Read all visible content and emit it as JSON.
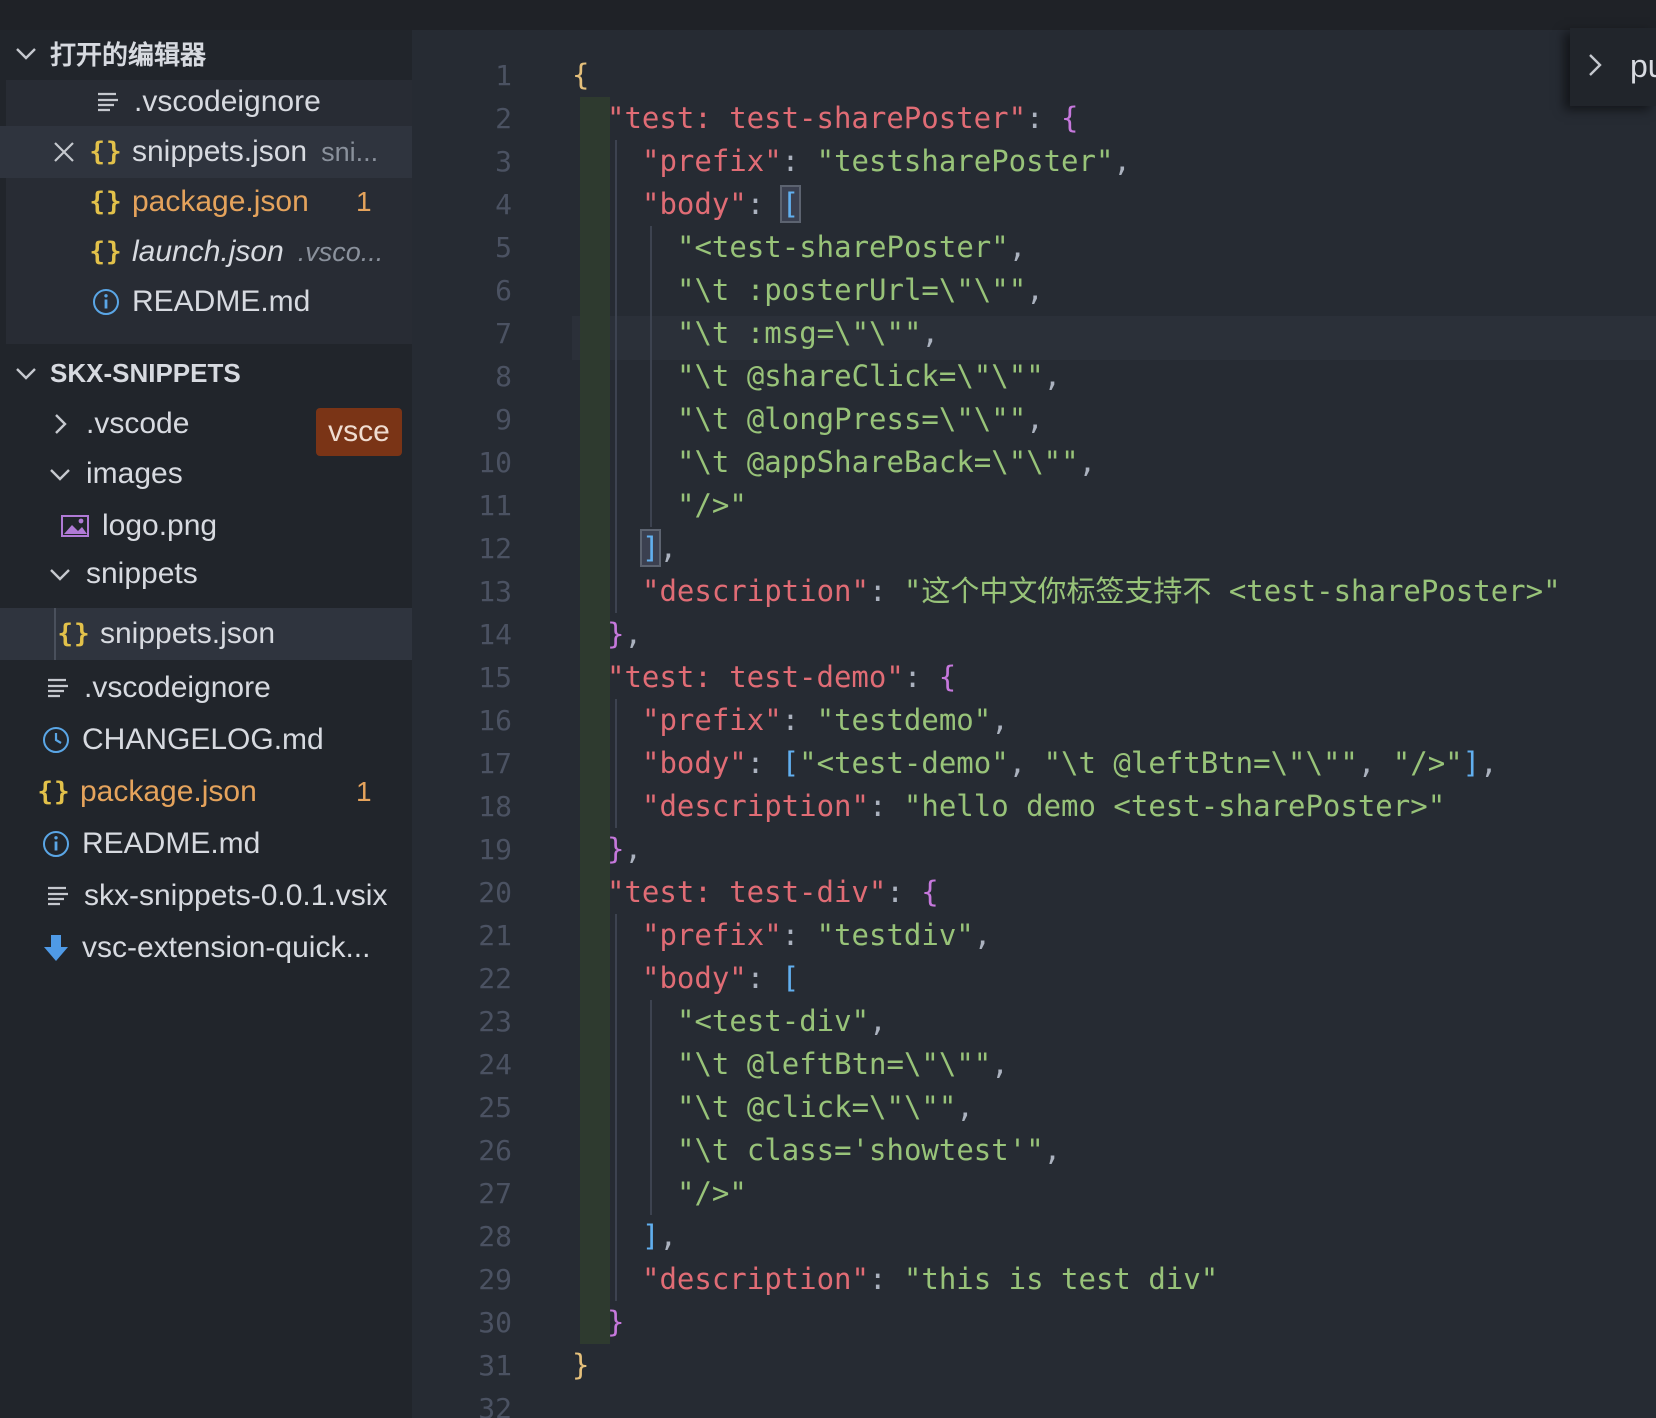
{
  "sidebar": {
    "open_editors_title": "打开的编辑器",
    "open_editors": [
      {
        "name": ".vscodeignore",
        "icon": "lines-icon",
        "desc": "",
        "badge": ""
      },
      {
        "name": "snippets.json",
        "icon": "braces-icon",
        "desc": "sni...",
        "badge": ""
      },
      {
        "name": "package.json",
        "icon": "braces-icon",
        "desc": "",
        "badge": "1"
      },
      {
        "name": "launch.json",
        "icon": "braces-icon",
        "desc": ".vsco...",
        "badge": ""
      },
      {
        "name": "README.md",
        "icon": "info-icon",
        "desc": "",
        "badge": ""
      }
    ],
    "braces_glyph": "{}",
    "project_title": "SKX-SNIPPETS",
    "tree": [
      {
        "name": ".vscode",
        "type": "folder-collapsed"
      },
      {
        "name": "images",
        "type": "folder-expanded"
      },
      {
        "name": "logo.png",
        "type": "image-file"
      },
      {
        "name": "snippets",
        "type": "folder-expanded"
      },
      {
        "name": "snippets.json",
        "type": "json-file"
      },
      {
        "name": ".vscodeignore",
        "type": "lines-file"
      },
      {
        "name": "CHANGELOG.md",
        "type": "clock-file"
      },
      {
        "name": "package.json",
        "type": "json-file",
        "badge": "1"
      },
      {
        "name": "README.md",
        "type": "info-file"
      },
      {
        "name": "skx-snippets-0.0.1.vsix",
        "type": "lines-file"
      },
      {
        "name": "vsc-extension-quick...",
        "type": "download-file"
      }
    ],
    "tooltip": "vsce"
  },
  "editor": {
    "peek_text": "pu",
    "line_numbers": [
      "1",
      "2",
      "3",
      "4",
      "5",
      "6",
      "7",
      "8",
      "9",
      "10",
      "11",
      "12",
      "13",
      "14",
      "15",
      "16",
      "17",
      "18",
      "19",
      "20",
      "21",
      "22",
      "23",
      "24",
      "25",
      "26",
      "27",
      "28",
      "29",
      "30",
      "31",
      "32"
    ],
    "lines": [
      {
        "indent": 0,
        "tokens": [
          {
            "t": "{",
            "c": "brace"
          }
        ]
      },
      {
        "indent": 1,
        "tokens": [
          {
            "t": "\"test: test-sharePoster\"",
            "c": "key"
          },
          {
            "t": ": ",
            "c": "punct"
          },
          {
            "t": "{",
            "c": "brace2"
          }
        ]
      },
      {
        "indent": 2,
        "tokens": [
          {
            "t": "\"prefix\"",
            "c": "key"
          },
          {
            "t": ": ",
            "c": "punct"
          },
          {
            "t": "\"testsharePoster\"",
            "c": "str"
          },
          {
            "t": ",",
            "c": "punct"
          }
        ]
      },
      {
        "indent": 2,
        "tokens": [
          {
            "t": "\"body\"",
            "c": "key"
          },
          {
            "t": ": ",
            "c": "punct"
          },
          {
            "t": "[",
            "c": "bracket-match"
          }
        ]
      },
      {
        "indent": 3,
        "tokens": [
          {
            "t": "\"<test-sharePoster\"",
            "c": "str"
          },
          {
            "t": ",",
            "c": "punct"
          }
        ]
      },
      {
        "indent": 3,
        "tokens": [
          {
            "t": "\"\\t :posterUrl=\\\"\\\"\"",
            "c": "str"
          },
          {
            "t": ",",
            "c": "punct"
          }
        ]
      },
      {
        "indent": 3,
        "tokens": [
          {
            "t": "\"\\t :msg=\\\"\\\"\"",
            "c": "str"
          },
          {
            "t": ",",
            "c": "punct"
          }
        ]
      },
      {
        "indent": 3,
        "tokens": [
          {
            "t": "\"\\t @shareClick=\\\"\\\"\"",
            "c": "str"
          },
          {
            "t": ",",
            "c": "punct"
          }
        ]
      },
      {
        "indent": 3,
        "tokens": [
          {
            "t": "\"\\t @longPress=\\\"\\\"\"",
            "c": "str"
          },
          {
            "t": ",",
            "c": "punct"
          }
        ]
      },
      {
        "indent": 3,
        "tokens": [
          {
            "t": "\"\\t @appShareBack=\\\"\\\"\"",
            "c": "str"
          },
          {
            "t": ",",
            "c": "punct"
          }
        ]
      },
      {
        "indent": 3,
        "tokens": [
          {
            "t": "\"/>\"",
            "c": "str"
          }
        ]
      },
      {
        "indent": 2,
        "tokens": [
          {
            "t": "]",
            "c": "bracket-match"
          },
          {
            "t": ",",
            "c": "punct"
          }
        ]
      },
      {
        "indent": 2,
        "tokens": [
          {
            "t": "\"description\"",
            "c": "key"
          },
          {
            "t": ": ",
            "c": "punct"
          },
          {
            "t": "\"这个中文你标签支持不 <test-sharePoster>\"",
            "c": "str"
          }
        ]
      },
      {
        "indent": 1,
        "tokens": [
          {
            "t": "}",
            "c": "brace2"
          },
          {
            "t": ",",
            "c": "punct"
          }
        ]
      },
      {
        "indent": 1,
        "tokens": [
          {
            "t": "\"test: test-demo\"",
            "c": "key"
          },
          {
            "t": ": ",
            "c": "punct"
          },
          {
            "t": "{",
            "c": "brace2"
          }
        ]
      },
      {
        "indent": 2,
        "tokens": [
          {
            "t": "\"prefix\"",
            "c": "key"
          },
          {
            "t": ": ",
            "c": "punct"
          },
          {
            "t": "\"testdemo\"",
            "c": "str"
          },
          {
            "t": ",",
            "c": "punct"
          }
        ]
      },
      {
        "indent": 2,
        "tokens": [
          {
            "t": "\"body\"",
            "c": "key"
          },
          {
            "t": ": ",
            "c": "punct"
          },
          {
            "t": "[",
            "c": "bracket"
          },
          {
            "t": "\"<test-demo\"",
            "c": "str"
          },
          {
            "t": ", ",
            "c": "punct"
          },
          {
            "t": "\"\\t @leftBtn=\\\"\\\"\"",
            "c": "str"
          },
          {
            "t": ", ",
            "c": "punct"
          },
          {
            "t": "\"/>\"",
            "c": "str"
          },
          {
            "t": "]",
            "c": "bracket"
          },
          {
            "t": ",",
            "c": "punct"
          }
        ]
      },
      {
        "indent": 2,
        "tokens": [
          {
            "t": "\"description\"",
            "c": "key"
          },
          {
            "t": ": ",
            "c": "punct"
          },
          {
            "t": "\"hello demo <test-sharePoster>\"",
            "c": "str"
          }
        ]
      },
      {
        "indent": 1,
        "tokens": [
          {
            "t": "}",
            "c": "brace2"
          },
          {
            "t": ",",
            "c": "punct"
          }
        ]
      },
      {
        "indent": 1,
        "tokens": [
          {
            "t": "\"test: test-div\"",
            "c": "key"
          },
          {
            "t": ": ",
            "c": "punct"
          },
          {
            "t": "{",
            "c": "brace2"
          }
        ]
      },
      {
        "indent": 2,
        "tokens": [
          {
            "t": "\"prefix\"",
            "c": "key"
          },
          {
            "t": ": ",
            "c": "punct"
          },
          {
            "t": "\"testdiv\"",
            "c": "str"
          },
          {
            "t": ",",
            "c": "punct"
          }
        ]
      },
      {
        "indent": 2,
        "tokens": [
          {
            "t": "\"body\"",
            "c": "key"
          },
          {
            "t": ": ",
            "c": "punct"
          },
          {
            "t": "[",
            "c": "bracket"
          }
        ]
      },
      {
        "indent": 3,
        "tokens": [
          {
            "t": "\"<test-div\"",
            "c": "str"
          },
          {
            "t": ",",
            "c": "punct"
          }
        ]
      },
      {
        "indent": 3,
        "tokens": [
          {
            "t": "\"\\t @leftBtn=\\\"\\\"\"",
            "c": "str"
          },
          {
            "t": ",",
            "c": "punct"
          }
        ]
      },
      {
        "indent": 3,
        "tokens": [
          {
            "t": "\"\\t @click=\\\"\\\"\"",
            "c": "str"
          },
          {
            "t": ",",
            "c": "punct"
          }
        ]
      },
      {
        "indent": 3,
        "tokens": [
          {
            "t": "\"\\t class='showtest'\"",
            "c": "str"
          },
          {
            "t": ",",
            "c": "punct"
          }
        ]
      },
      {
        "indent": 3,
        "tokens": [
          {
            "t": "\"/>\"",
            "c": "str"
          }
        ]
      },
      {
        "indent": 2,
        "tokens": [
          {
            "t": "]",
            "c": "bracket"
          },
          {
            "t": ",",
            "c": "punct"
          }
        ]
      },
      {
        "indent": 2,
        "tokens": [
          {
            "t": "\"description\"",
            "c": "key"
          },
          {
            "t": ": ",
            "c": "punct"
          },
          {
            "t": "\"this is test div\"",
            "c": "str"
          }
        ]
      },
      {
        "indent": 1,
        "tokens": [
          {
            "t": "}",
            "c": "brace2"
          }
        ]
      },
      {
        "indent": 0,
        "tokens": [
          {
            "t": "}",
            "c": "brace"
          }
        ]
      },
      {
        "indent": 0,
        "tokens": []
      }
    ]
  },
  "colors": {
    "key": "#e06c75",
    "string": "#98c379",
    "brace": "#e5c07b",
    "brace2": "#c678dd",
    "bracket": "#61afef",
    "modified": "#e5a35c",
    "tooltip_bg": "#7a3416"
  }
}
